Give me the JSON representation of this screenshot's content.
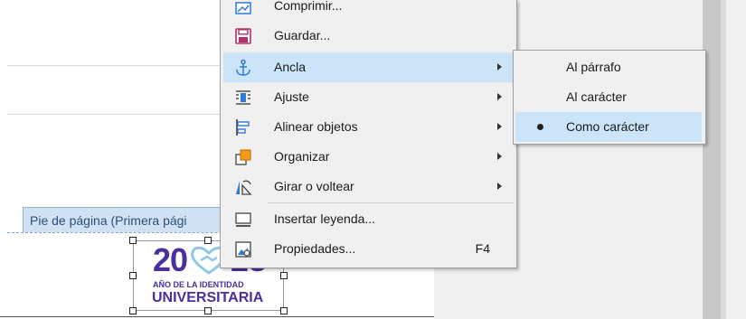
{
  "document": {
    "footer_tab_label": "Pie de página (Primera pági",
    "logo": {
      "year_left": "20",
      "year_right": "25",
      "subtitle": "AÑO DE LA IDENTIDAD",
      "title": "UNIVERSITARIA",
      "color": "#4a2f9d"
    }
  },
  "context_menu": {
    "items": [
      {
        "label": "Comprimir...",
        "icon": "compress-icon",
        "submenu": false
      },
      {
        "label": "Guardar...",
        "icon": "save-icon",
        "submenu": false
      },
      {
        "label": "Ancla",
        "icon": "anchor-icon",
        "submenu": true,
        "highlighted": true
      },
      {
        "label": "Ajuste",
        "icon": "wrap-icon",
        "submenu": true
      },
      {
        "label": "Alinear objetos",
        "icon": "align-objects-icon",
        "submenu": true
      },
      {
        "label": "Organizar",
        "icon": "arrange-icon",
        "submenu": true
      },
      {
        "label": "Girar o voltear",
        "icon": "rotate-flip-icon",
        "submenu": true
      },
      {
        "label": "Insertar leyenda...",
        "icon": "caption-icon",
        "submenu": false
      },
      {
        "label": "Propiedades...",
        "icon": "properties-icon",
        "submenu": false,
        "shortcut": "F4"
      }
    ]
  },
  "anchor_submenu": {
    "items": [
      {
        "label": "Al párrafo"
      },
      {
        "label": "Al carácter"
      },
      {
        "label": "Como carácter",
        "selected": true,
        "highlighted": true
      }
    ]
  },
  "colors": {
    "highlight": "#cce4f7",
    "menu_bg": "#f0f0f0",
    "icon_blue": "#2f7ad2",
    "icon_orange": "#f59a1b",
    "icon_magenta": "#b0306a"
  }
}
